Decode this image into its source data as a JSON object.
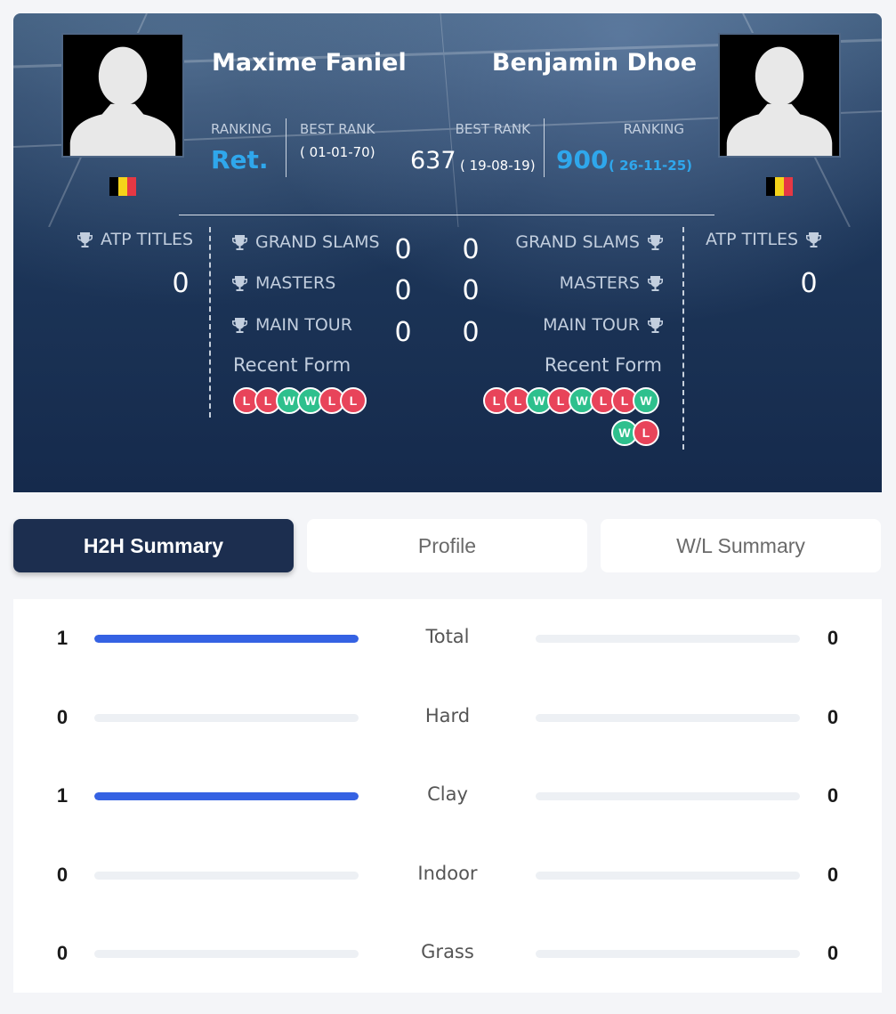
{
  "player1": {
    "name": "Maxime Faniel",
    "ranking_label": "RANKING",
    "ranking": "Ret.",
    "best_rank_label": "BEST RANK",
    "best_rank_date": "( 01-01-70)",
    "atp_titles_label": "ATP TITLES",
    "atp_titles": "0",
    "grand_slams_label": "GRAND SLAMS",
    "grand_slams": "0",
    "masters_label": "MASTERS",
    "masters": "0",
    "main_tour_label": "MAIN TOUR",
    "main_tour": "0",
    "recent_form_label": "Recent Form",
    "recent_form": [
      "L",
      "L",
      "W",
      "W",
      "L",
      "L"
    ],
    "flag_colors": [
      "#000000",
      "#f5d31a",
      "#e53844"
    ]
  },
  "player2": {
    "name": "Benjamin Dhoe",
    "ranking_label": "RANKING",
    "ranking": "900",
    "ranking_date": "( 26-11-25)",
    "best_rank_label": "BEST RANK",
    "best_rank": "637",
    "best_rank_date": "( 19-08-19)",
    "atp_titles_label": "ATP TITLES",
    "atp_titles": "0",
    "grand_slams_label": "GRAND SLAMS",
    "grand_slams": "0",
    "masters_label": "MASTERS",
    "masters": "0",
    "main_tour_label": "MAIN TOUR",
    "main_tour": "0",
    "recent_form_label": "Recent Form",
    "recent_form": [
      "L",
      "L",
      "W",
      "L",
      "W",
      "L",
      "L",
      "W",
      "W",
      "L"
    ],
    "flag_colors": [
      "#000000",
      "#f5d31a",
      "#e53844"
    ]
  },
  "tabs": [
    {
      "label": "H2H Summary",
      "active": true
    },
    {
      "label": "Profile",
      "active": false
    },
    {
      "label": "W/L Summary",
      "active": false
    }
  ],
  "h2h": [
    {
      "surface": "Total",
      "p1": "1",
      "p2": "0",
      "p1_share": 1.0,
      "p2_share": 0.0
    },
    {
      "surface": "Hard",
      "p1": "0",
      "p2": "0",
      "p1_share": 0.0,
      "p2_share": 0.0
    },
    {
      "surface": "Clay",
      "p1": "1",
      "p2": "0",
      "p1_share": 1.0,
      "p2_share": 0.0
    },
    {
      "surface": "Indoor",
      "p1": "0",
      "p2": "0",
      "p1_share": 0.0,
      "p2_share": 0.0
    },
    {
      "surface": "Grass",
      "p1": "0",
      "p2": "0",
      "p1_share": 0.0,
      "p2_share": 0.0
    }
  ],
  "colors": {
    "accent_blue": "#2fa7ec",
    "bar_fill": "#3562e3",
    "loss": "#e8445a",
    "win": "#2ec08d",
    "active_tab": "#1c2e4f"
  }
}
